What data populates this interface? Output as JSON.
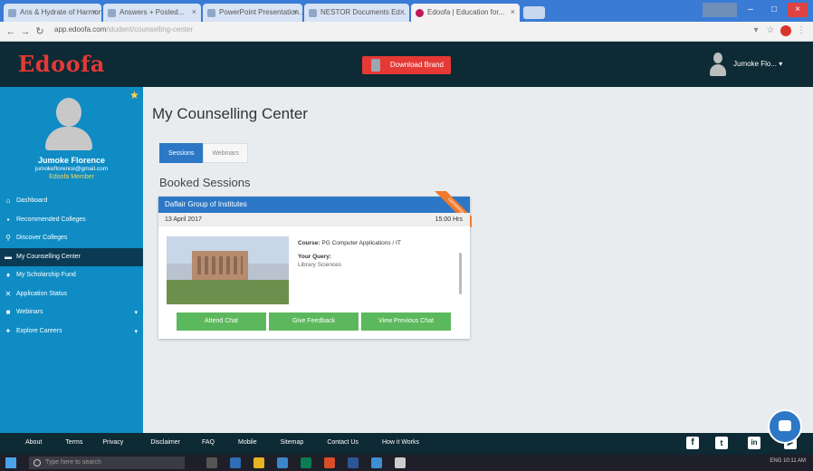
{
  "browser": {
    "tabs": [
      {
        "label": "Ans & Hydrate of Harmon | Lin...",
        "active": false
      },
      {
        "label": "Answers + Posted...",
        "active": false
      },
      {
        "label": "PowerPoint Presentation...",
        "active": false
      },
      {
        "label": "NESTOR Documents Ed...",
        "active": false
      },
      {
        "label": "Edoofa | Education for...",
        "active": true
      }
    ],
    "url": "app.edoofa.com",
    "url_path": "/student/counselling-center"
  },
  "header": {
    "logo": "Edoofa",
    "download_label": "Download Brand",
    "user_name": "Jumoke Flo..."
  },
  "sidebar": {
    "name": "Jumoke Florence",
    "email": "jumokeflorence@gmail.com",
    "member": "Edoofa Member",
    "items": [
      {
        "icon": "home-icon",
        "glyph": "⌂",
        "label": "Dashboard",
        "active": false,
        "caret": ""
      },
      {
        "icon": "building-icon",
        "glyph": "▪",
        "label": "Recommended Colleges",
        "active": false,
        "caret": ""
      },
      {
        "icon": "search-icon",
        "glyph": "⚲",
        "label": "Discover Colleges",
        "active": false,
        "caret": ""
      },
      {
        "icon": "comment-icon",
        "glyph": "▬",
        "label": "My Counselling Center",
        "active": true,
        "caret": ""
      },
      {
        "icon": "trophy-icon",
        "glyph": "♦",
        "label": "My Scholarship Fund",
        "active": false,
        "caret": ""
      },
      {
        "icon": "status-icon",
        "glyph": "✕",
        "label": "Application Status",
        "active": false,
        "caret": ""
      },
      {
        "icon": "webinar-icon",
        "glyph": "■",
        "label": "Webinars",
        "active": false,
        "caret": "▾"
      },
      {
        "icon": "compass-icon",
        "glyph": "✦",
        "label": "Explore Careers",
        "active": false,
        "caret": "▾"
      }
    ]
  },
  "main": {
    "title": "My Counselling Center",
    "tabs": [
      {
        "label": "Sessions",
        "active": true
      },
      {
        "label": "Webinars",
        "active": false
      }
    ],
    "section_title": "Booked Sessions",
    "session": {
      "college": "Daflair Group of Institutes",
      "ribbon": "Upcoming",
      "date": "13 April 2017",
      "time": "15:00 Hrs",
      "course_label": "Course:",
      "course_value": "PG Computer Applications / IT",
      "query_label": "Your Query:",
      "query_value": "Library Sciences",
      "buttons": [
        "Attend Chat",
        "Give Feedback",
        "View Previous Chat"
      ]
    }
  },
  "footer": {
    "links": [
      "About",
      "Terms",
      "Privacy",
      "Disclaimer",
      "FAQ",
      "Mobile",
      "Sitemap",
      "Contact Us",
      "How it Works"
    ],
    "social": [
      {
        "icon": "facebook-icon",
        "glyph": "f"
      },
      {
        "icon": "twitter-icon",
        "glyph": "t"
      },
      {
        "icon": "linkedin-icon",
        "glyph": "in"
      },
      {
        "icon": "youtube-icon",
        "glyph": "▶"
      }
    ]
  },
  "taskbar": {
    "search_placeholder": "Type here to search",
    "tray_text": "ENG  10:11 AM"
  }
}
